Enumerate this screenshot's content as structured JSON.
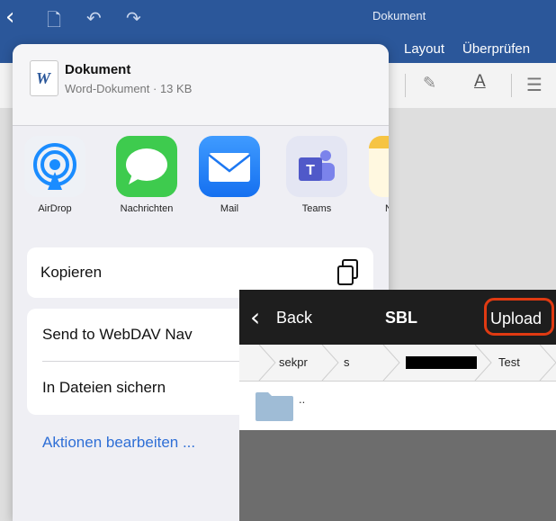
{
  "app": {
    "document_title": "Dokument",
    "ribbon_tabs": [
      "Layout",
      "Überprüfen"
    ],
    "toolbar": {
      "font_color_letter": "A"
    }
  },
  "share_sheet": {
    "file": {
      "icon_letter": "W",
      "name": "Dokument",
      "meta": "Word-Dokument · 13 KB"
    },
    "apps": [
      {
        "label": "AirDrop",
        "icon": "airdrop-icon"
      },
      {
        "label": "Nachrichten",
        "icon": "messages-icon"
      },
      {
        "label": "Mail",
        "icon": "mail-icon"
      },
      {
        "label": "Teams",
        "icon": "teams-icon"
      },
      {
        "label": "N",
        "icon": "notes-icon"
      }
    ],
    "actions": {
      "copy": "Kopieren",
      "send_webdav": "Send to WebDAV Nav",
      "save_files": "In Dateien sichern",
      "edit_actions": "Aktionen bearbeiten ..."
    }
  },
  "sbl_panel": {
    "back": "Back",
    "title": "SBL",
    "upload": "Upload",
    "breadcrumbs": [
      "sekpr",
      "s",
      "Test"
    ],
    "items": [
      ".."
    ]
  },
  "colors": {
    "word_blue": "#2b579a",
    "action_link": "#2f6fd6",
    "upload_highlight": "#e03a12",
    "panel_dark": "#1e1e1e"
  }
}
